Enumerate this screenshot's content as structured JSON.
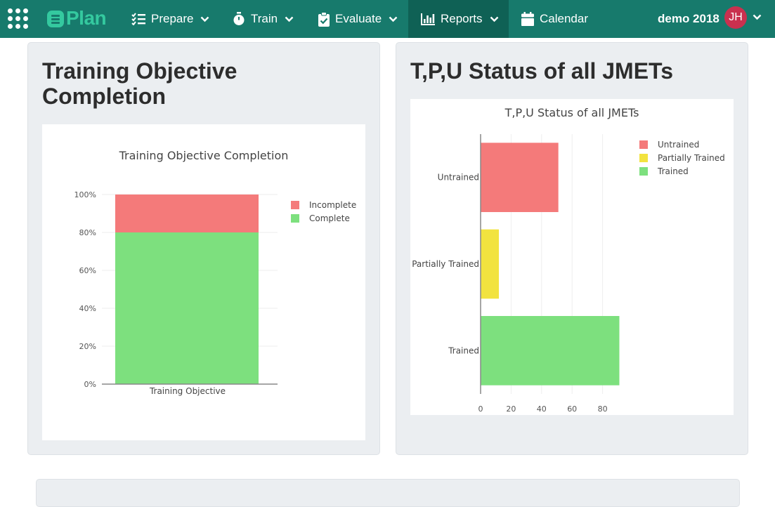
{
  "nav": {
    "logo_text": "Plan",
    "items": [
      {
        "label": "Prepare",
        "icon": "checklist-icon"
      },
      {
        "label": "Train",
        "icon": "stopwatch-icon"
      },
      {
        "label": "Evaluate",
        "icon": "clipboard-check-icon"
      },
      {
        "label": "Reports",
        "icon": "bar-chart-icon",
        "active": true
      },
      {
        "label": "Calendar",
        "icon": "calendar-icon"
      }
    ],
    "user_name": "demo 2018",
    "user_initials": "JH"
  },
  "colors": {
    "nav_bg": "#177a6c",
    "nav_active": "#0f6155",
    "brand_accent": "#34c99f",
    "untrained": "#f47a7a",
    "partially_trained": "#f2e33f",
    "trained": "#7de07e",
    "incomplete": "#f47a7a",
    "complete": "#7de07e"
  },
  "cards": {
    "left_title": "Training Objective Completion",
    "right_title": "T,P,U Status of all JMETs"
  },
  "chart_data": [
    {
      "type": "bar",
      "orientation": "vertical",
      "stacked": true,
      "title": "Training Objective Completion",
      "categories": [
        "Training Objective"
      ],
      "series": [
        {
          "name": "Complete",
          "values": [
            80
          ],
          "color": "#7de07e"
        },
        {
          "name": "Incomplete",
          "values": [
            20
          ],
          "color": "#f47a7a"
        }
      ],
      "ylim": [
        0,
        100
      ],
      "ytick_labels": [
        "0%",
        "20%",
        "40%",
        "60%",
        "80%",
        "100%"
      ],
      "legend": [
        "Incomplete",
        "Complete"
      ],
      "legend_position": "top-right",
      "grid": true
    },
    {
      "type": "bar",
      "orientation": "horizontal",
      "title": "T,P,U Status of all JMETs",
      "categories": [
        "Untrained",
        "Partially Trained",
        "Trained"
      ],
      "values": [
        51,
        12,
        91
      ],
      "colors": [
        "#f47a7a",
        "#f2e33f",
        "#7de07e"
      ],
      "xlim": [
        0,
        100
      ],
      "xtick_labels": [
        "0",
        "20",
        "40",
        "60",
        "80"
      ],
      "legend": [
        "Untrained",
        "Partially Trained",
        "Trained"
      ],
      "legend_position": "top-right",
      "grid": true
    }
  ]
}
